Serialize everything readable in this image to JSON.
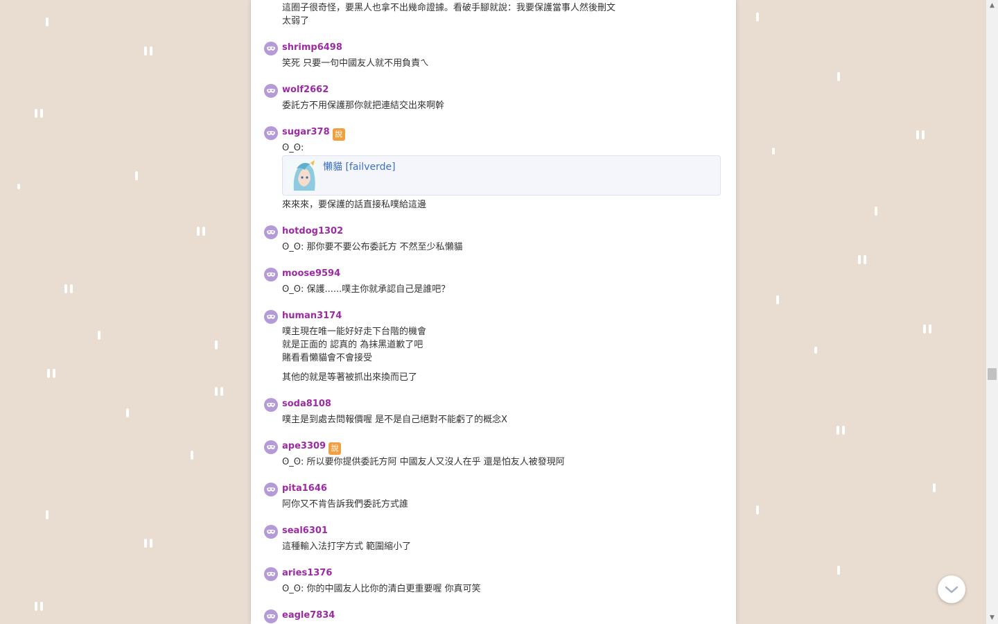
{
  "comments": [
    {
      "lines": [
        "這圈子很奇怪，要黑人也拿不出幾命證據。看破手腳就說：我要保護當事人然後刪文",
        "太弱了"
      ]
    },
    {
      "name": "shrimp6498",
      "lines": [
        "笑死 只要一句中國友人就不用負責ㄟ"
      ]
    },
    {
      "name": "wolf2662",
      "lines": [
        "委託方不用保護那你就把連結交出來啊幹"
      ]
    },
    {
      "name": "sugar378",
      "badge": "說",
      "lines": [
        "ʘ_ʘ:"
      ],
      "link_title": "懶貓 [failverde]",
      "after_lines": [
        "來來來，要保護的話直接私噗給這邊"
      ]
    },
    {
      "name": "hotdog1302",
      "lines": [
        "ʘ_ʘ: 那你要不要公布委託方 不然至少私懶貓"
      ]
    },
    {
      "name": "moose9594",
      "lines": [
        "ʘ_ʘ: 保護......噗主你就承認自己是誰吧？"
      ]
    },
    {
      "name": "human3174",
      "lines": [
        "噗主現在唯一能好好走下台階的機會",
        "就是正面的 認真的 為抹黑道歉了吧",
        "賭看看懶貓會不會接受"
      ],
      "after_lines": [
        "其他的就是等著被抓出來換而已了"
      ]
    },
    {
      "name": "soda8108",
      "lines": [
        "噗主是到處去問報價喔 是不是自己絕對不能虧了的概念X"
      ]
    },
    {
      "name": "ape3309",
      "badge": "說",
      "lines": [
        "ʘ_ʘ: 所以要你提供委託方阿 中國友人又沒人在乎 還是怕友人被發現阿"
      ]
    },
    {
      "name": "pita1646",
      "lines": [
        "阿你又不肯告訴我們委託方式誰"
      ]
    },
    {
      "name": "seal6301",
      "lines": [
        "這種輸入法打字方式 範圍縮小了"
      ]
    },
    {
      "name": "aries1376",
      "lines": [
        "ʘ_ʘ: 你的中國友人比你的清白更重要喔 你真可笑"
      ]
    },
    {
      "name": "eagle7834",
      "lines": []
    }
  ],
  "icons": {
    "avatar": "anonymous-mask-icon",
    "scroll_down": "chevron-down-icon"
  },
  "colors": {
    "username": "#9c2aa3",
    "badge": "#f0a040",
    "avatar": "#b59ad8",
    "background": "#e8ddd0"
  }
}
